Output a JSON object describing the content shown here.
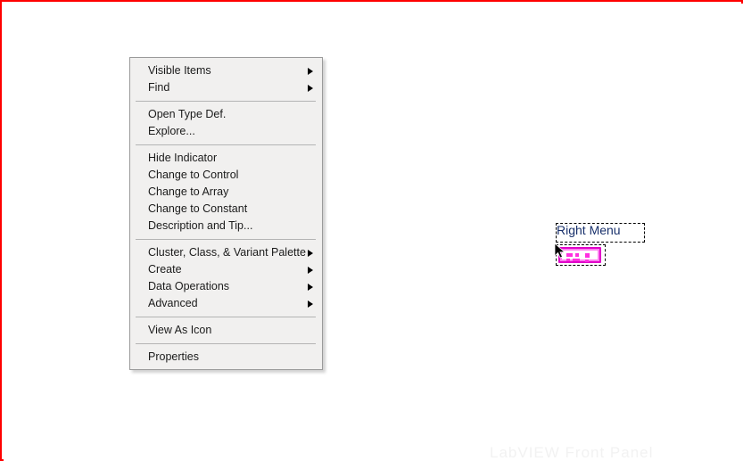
{
  "window": {
    "background_color": "#ffffff",
    "frame_color": "#ff0000"
  },
  "watermark": {
    "text": "LabVIEW Front Panel"
  },
  "context_menu": {
    "background_color": "#f1f0ef",
    "border_color": "#9a9a9a",
    "text_color": "#1b1b1b",
    "groups": [
      {
        "items": [
          {
            "label": "Visible Items",
            "has_submenu": true
          },
          {
            "label": "Find",
            "has_submenu": true
          }
        ]
      },
      {
        "items": [
          {
            "label": "Open Type Def.",
            "has_submenu": false
          },
          {
            "label": "Explore...",
            "has_submenu": false
          }
        ]
      },
      {
        "items": [
          {
            "label": "Hide Indicator",
            "has_submenu": false
          },
          {
            "label": "Change to Control",
            "has_submenu": false
          },
          {
            "label": "Change to Array",
            "has_submenu": false
          },
          {
            "label": "Change to Constant",
            "has_submenu": false
          },
          {
            "label": "Description and Tip...",
            "has_submenu": false
          }
        ]
      },
      {
        "items": [
          {
            "label": "Cluster, Class, & Variant Palette",
            "has_submenu": true
          },
          {
            "label": "Create",
            "has_submenu": true
          },
          {
            "label": "Data Operations",
            "has_submenu": true
          },
          {
            "label": "Advanced",
            "has_submenu": true
          }
        ]
      },
      {
        "items": [
          {
            "label": "View As Icon",
            "has_submenu": false
          }
        ]
      },
      {
        "items": [
          {
            "label": "Properties",
            "has_submenu": false
          }
        ]
      }
    ]
  },
  "front_panel_object": {
    "label": "Right Menu",
    "label_color": "#18306b",
    "terminal_color": "#ff7ff0",
    "terminal_border_color": "#e000c8",
    "selected": true
  }
}
